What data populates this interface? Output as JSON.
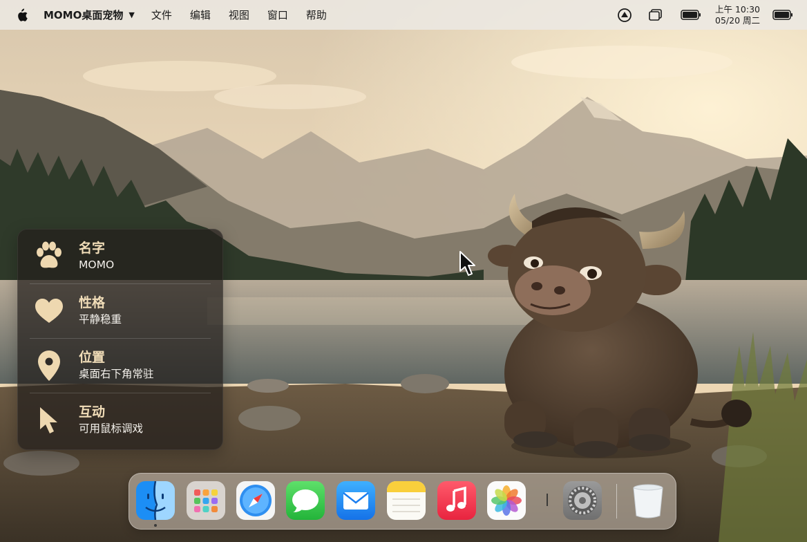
{
  "menubar": {
    "app_name": "MOMO桌面宠物",
    "items": [
      "文件",
      "编辑",
      "视图",
      "窗口",
      "帮助"
    ],
    "clock_time": "上午 10:30",
    "clock_date": "05/20 周二",
    "icons": [
      "apple-icon",
      "app-menu-caret-icon",
      "status-tray-icon",
      "window-icon",
      "battery-icon",
      "battery-icon"
    ]
  },
  "panel": {
    "rows": [
      {
        "icon": "paw-icon",
        "title": "名字",
        "value": "MOMO"
      },
      {
        "icon": "heart-icon",
        "title": "性格",
        "value": "平静稳重"
      },
      {
        "icon": "location-pin-icon",
        "title": "位置",
        "value": "桌面右下角常驻"
      },
      {
        "icon": "pointer-arrow-icon",
        "title": "互动",
        "value": "可用鼠标调戏"
      }
    ]
  },
  "dock": {
    "apps": [
      "finder-icon",
      "launchpad-icon",
      "safari-icon",
      "messages-icon",
      "mail-icon",
      "notes-icon",
      "music-icon",
      "photos-icon",
      "system-settings-icon",
      "trash-icon"
    ]
  },
  "colors": {
    "panel_title": "#f1ddb8",
    "panel_icon": "#eed8b0",
    "menubar_bg": "#ece8e2"
  }
}
